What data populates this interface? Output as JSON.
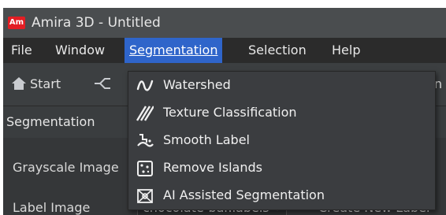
{
  "window": {
    "app_logo": "Am",
    "title": "Amira 3D - Untitled"
  },
  "menubar": {
    "items": [
      {
        "label": "File"
      },
      {
        "label": "Window"
      },
      {
        "label": "Segmentation",
        "active": true
      },
      {
        "label": "Selection"
      },
      {
        "label": "Help"
      }
    ]
  },
  "toolbar": {
    "start_label": "Start",
    "start_icon": "home-icon",
    "flow_icon": "workflow-icon",
    "clipped_text": "n"
  },
  "panel": {
    "title": "Segmentation",
    "grayscale_label": "Grayscale Image",
    "label_image_label": "Label Image",
    "label_image_value": "chocolate-bar.labels",
    "create_button": "Create New Label"
  },
  "segmentation_menu": {
    "items": [
      {
        "label": "Watershed",
        "icon": "watershed-icon"
      },
      {
        "label": "Texture Classification",
        "icon": "texture-classification-icon"
      },
      {
        "label": "Smooth Label",
        "icon": "smooth-label-icon"
      },
      {
        "label": "Remove Islands",
        "icon": "remove-islands-icon"
      },
      {
        "label": "AI Assisted Segmentation",
        "icon": "ai-segmentation-icon"
      }
    ]
  },
  "colors": {
    "menu_highlight": "#2f65ca",
    "logo_red": "#e31e24",
    "background": "#3c3f41"
  }
}
